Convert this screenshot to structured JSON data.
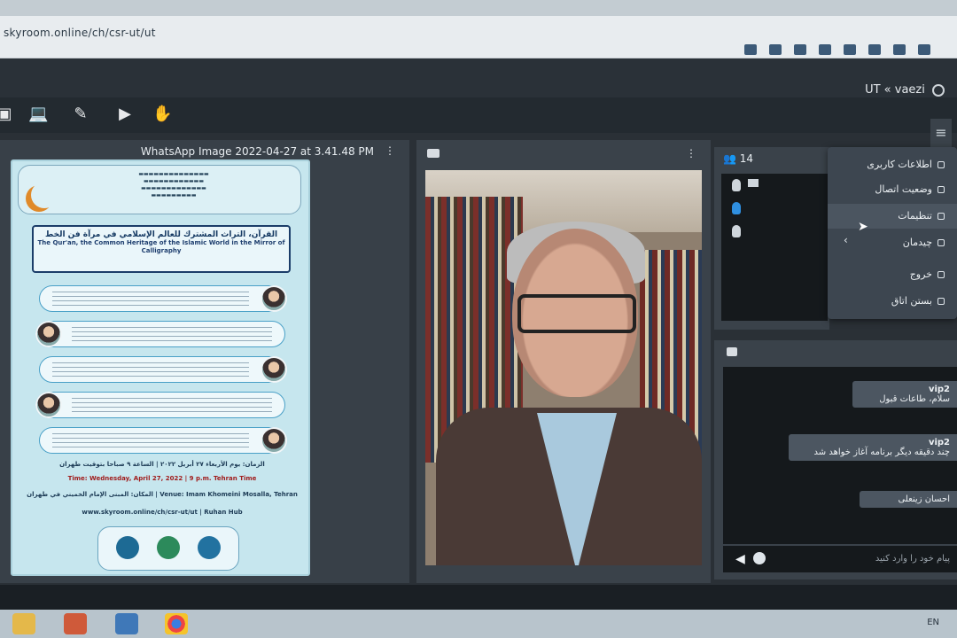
{
  "browser": {
    "url": "skyroom.online/ch/csr-ut/ut",
    "icons": [
      "camera-icon",
      "key-icon",
      "translate-icon",
      "share-icon",
      "star-icon",
      "extension-icon",
      "sidebar-icon",
      "profile-icon"
    ]
  },
  "header": {
    "user_label": "UT « vaezi"
  },
  "toolbar": {
    "tools": [
      "screen-share-icon",
      "whiteboard-icon",
      "brush-icon",
      "play-file-icon",
      "raise-hand-icon"
    ]
  },
  "document": {
    "title": "WhatsApp Image 2022-04-27 at 3.41.48 PM",
    "kebab": "⋮",
    "poster": {
      "title_ar": "القرآن، التراث المشترك للعالم الإسلامي في مرآة فن الخط",
      "title_en": "The Qur'an, the Common Heritage of the Islamic World in the Mirror of Calligraphy",
      "date_ar": "الزمان: يوم الأربعاء ٢٧ أبريل ٢٠٢٢ | الساعة ٩ صباحا بتوقيت طهران",
      "date_en": "Time: Wednesday, April 27, 2022 | 9 p.m. Tehran Time",
      "venue": "المكان: المبنى الإمام الخميني في طهران | Venue: Imam Khomeini Mosalla, Tehran",
      "url": "www.skyroom.online/ch/csr-ut/ut | Ruhan Hub"
    }
  },
  "video": {
    "kebab": "⋮"
  },
  "participants": {
    "count": "14"
  },
  "menu": {
    "items": [
      {
        "label": "اطلاعات کاربری"
      },
      {
        "label": "وضعیت اتصال"
      },
      {
        "label": "تنظیمات"
      },
      {
        "label": "چیدمان"
      },
      {
        "label": "خروج"
      },
      {
        "label": "بستن اتاق"
      }
    ]
  },
  "chat": {
    "messages": [
      {
        "user": "vip2",
        "text": "سلام، طاعات قبول"
      },
      {
        "user": "vip2",
        "text": "چند دقیقه دیگر برنامه آغاز خواهد شد"
      },
      {
        "user": "",
        "text": "احسان زینعلی"
      }
    ],
    "input_placeholder": "پیام خود را وارد کنید"
  },
  "taskbar": {
    "tray": "EN"
  }
}
